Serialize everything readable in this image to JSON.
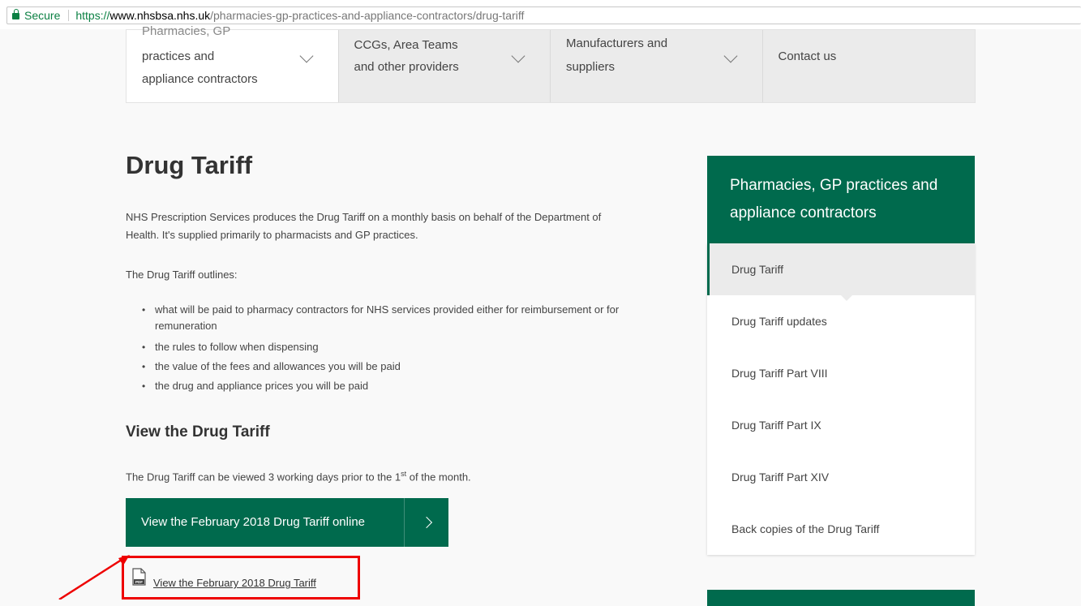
{
  "browser": {
    "secure_label": "Secure",
    "url_scheme": "https://",
    "url_host": "www.nhsbsa.nhs.uk",
    "url_path": "/pharmacies-gp-practices-and-appliance-contractors/drug-tariff"
  },
  "nav": {
    "items": [
      {
        "line0": "Pharmacies, GP",
        "line1": "practices and",
        "line2": "appliance contractors"
      },
      {
        "line1": "CCGs, Area Teams",
        "line2": "and other providers"
      },
      {
        "line1": "Manufacturers and",
        "line2": "suppliers"
      },
      {
        "line1": "Contact us"
      }
    ]
  },
  "main": {
    "title": "Drug Tariff",
    "intro_line1": "NHS Prescription Services produces the Drug Tariff on a monthly basis on behalf of the Department of",
    "intro_line2": "Health. It's supplied primarily to pharmacists and GP practices.",
    "outline_intro": "The Drug Tariff outlines:",
    "bullets": [
      {
        "line1": "what will be paid to pharmacy contractors for NHS services provided either for reimbursement or for",
        "line2": "remuneration"
      },
      {
        "line1": "the rules to follow when dispensing"
      },
      {
        "line1": "the value of the fees and allowances you will be paid"
      },
      {
        "line1": "the drug and appliance prices you will be paid"
      }
    ],
    "view_heading": "View the Drug Tariff",
    "view_text_before": "The Drug Tariff can be viewed 3 working days prior to the 1",
    "view_text_sup": "st",
    "view_text_after": " of the month.",
    "online_button": "View the February 2018 Drug Tariff online",
    "pdf_link": "View the February 2018 Drug Tariff"
  },
  "sidebar": {
    "heading_line1": "Pharmacies, GP practices and",
    "heading_line2": "appliance contractors",
    "items": [
      "Drug Tariff",
      "Drug Tariff updates",
      "Drug Tariff Part VIII",
      "Drug Tariff Part IX",
      "Drug Tariff Part XIV",
      "Back copies of the Drug Tariff"
    ]
  },
  "colors": {
    "brand_green": "#006a4d",
    "annotation_red": "#ee0000"
  }
}
